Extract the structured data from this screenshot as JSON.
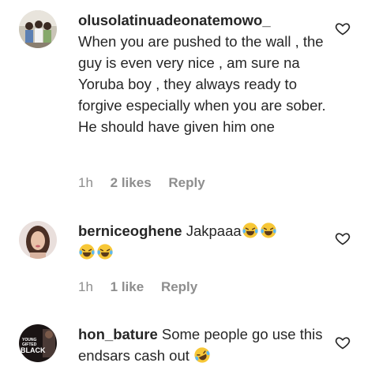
{
  "comments": [
    {
      "username": "olusolatinuadeonatemowo_",
      "text": "When you are pushed to the wall , the guy is even very nice , am sure na Yoruba boy , they always ready to forgive especially when you are sober. He should have given him one",
      "time": "1h",
      "likes": "2 likes",
      "reply": "Reply"
    },
    {
      "username": "berniceoghene",
      "text": "Jakpaaa",
      "emoji": [
        "laughing-crying",
        "laughing-crying",
        "laughing-crying",
        "laughing-crying"
      ],
      "time": "1h",
      "likes": "1 like",
      "reply": "Reply"
    },
    {
      "username": "hon_bature",
      "text": "Some people go use this endsars cash out",
      "emoji": [
        "rolling-laughing"
      ],
      "avatar_text": [
        "YOUNG",
        "GIFTED",
        "BLACK"
      ]
    }
  ],
  "colors": {
    "text": "#262626",
    "meta": "#8e8e8e",
    "heart_outline": "#262626"
  }
}
